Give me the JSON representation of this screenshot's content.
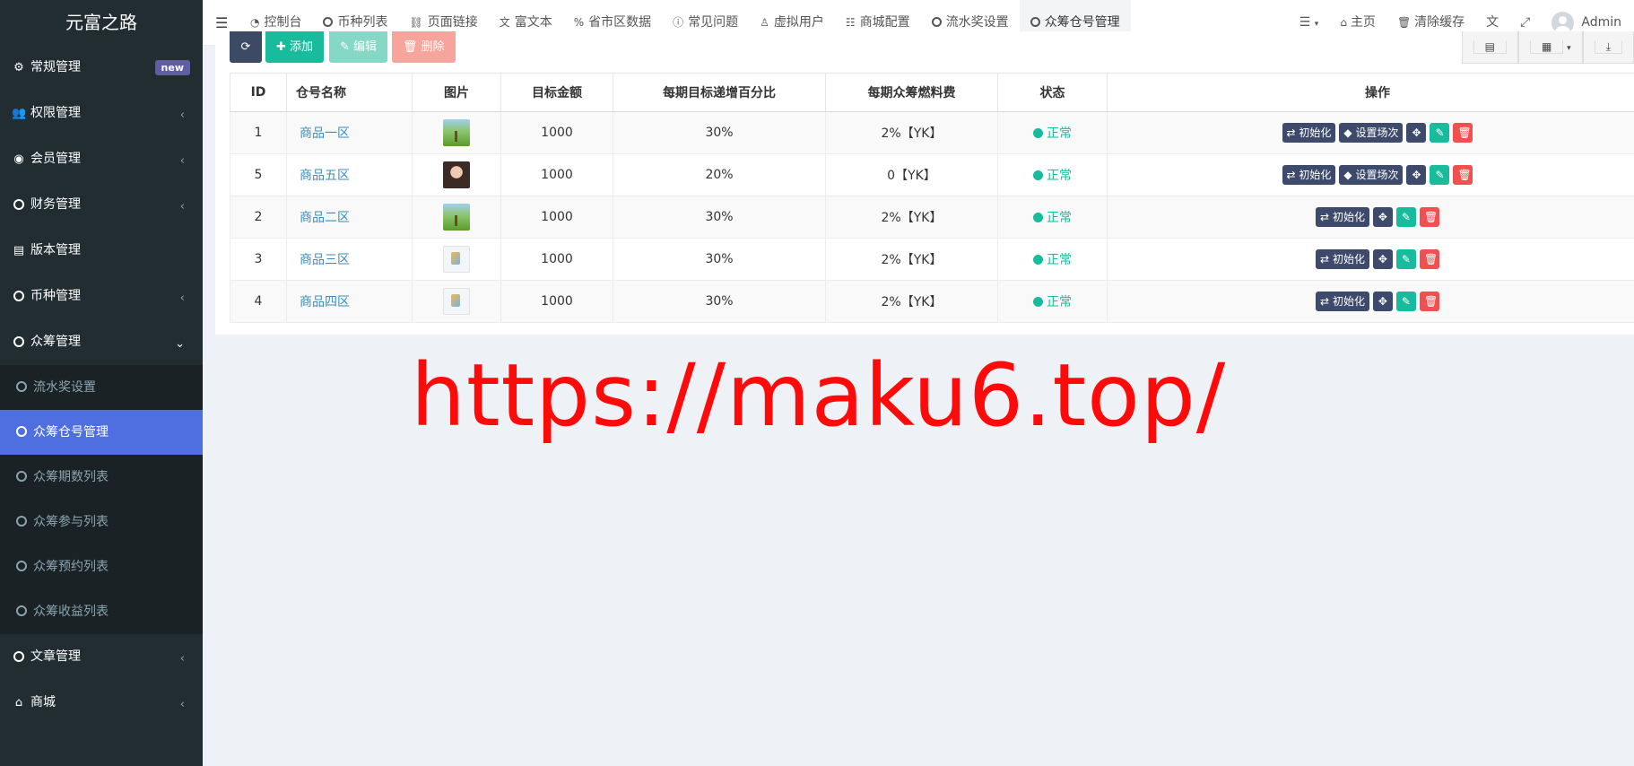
{
  "app": {
    "logo": "元富之路"
  },
  "sidebar": {
    "items": [
      {
        "icon": "cogs-icon",
        "label": "常规管理",
        "badge": "new"
      },
      {
        "icon": "users-icon",
        "label": "权限管理"
      },
      {
        "icon": "user-circle-icon",
        "label": "会员管理"
      },
      {
        "icon": "circle-icon",
        "label": "财务管理"
      },
      {
        "icon": "file-icon",
        "label": "版本管理"
      },
      {
        "icon": "circle-icon",
        "label": "币种管理"
      },
      {
        "icon": "circle-icon",
        "label": "众筹管理"
      }
    ],
    "submenu": [
      {
        "label": "流水奖设置"
      },
      {
        "label": "众筹仓号管理",
        "active": true
      },
      {
        "label": "众筹期数列表"
      },
      {
        "label": "众筹参与列表"
      },
      {
        "label": "众筹预约列表"
      },
      {
        "label": "众筹收益列表"
      }
    ],
    "after": [
      {
        "icon": "circle-icon",
        "label": "文章管理"
      },
      {
        "icon": "home-icon",
        "label": "商城"
      }
    ]
  },
  "topnav": {
    "tabs": [
      {
        "icon": "dashboard-icon",
        "label": "控制台"
      },
      {
        "icon": "circle-icon",
        "label": "币种列表"
      },
      {
        "icon": "link-icon",
        "label": "页面链接"
      },
      {
        "icon": "translate-icon",
        "label": "富文本"
      },
      {
        "icon": "percent-icon",
        "label": "省市区数据"
      },
      {
        "icon": "info-icon",
        "label": "常见问题"
      },
      {
        "icon": "user-icon",
        "label": "虚拟用户"
      },
      {
        "icon": "sliders-icon",
        "label": "商城配置"
      },
      {
        "icon": "circle-icon",
        "label": "流水奖设置"
      },
      {
        "icon": "circle-icon",
        "label": "众筹仓号管理",
        "active": true
      }
    ],
    "right": {
      "home": "主页",
      "clear_cache": "清除缓存",
      "user": "Admin"
    }
  },
  "toolbar": {
    "add": "添加",
    "edit": "编辑",
    "delete": "删除"
  },
  "table": {
    "headers": [
      "ID",
      "仓号名称",
      "图片",
      "目标金额",
      "每期目标递增百分比",
      "每期众筹燃料费",
      "状态",
      "操作"
    ],
    "rows": [
      {
        "id": "1",
        "name": "商品一区",
        "image": "tree",
        "target": "1000",
        "pct": "30%",
        "fee": "2%【YK】",
        "status": "正常",
        "set_scene": true
      },
      {
        "id": "5",
        "name": "商品五区",
        "image": "portrait",
        "target": "1000",
        "pct": "20%",
        "fee": "0【YK】",
        "status": "正常",
        "set_scene": true
      },
      {
        "id": "2",
        "name": "商品二区",
        "image": "tree",
        "target": "1000",
        "pct": "30%",
        "fee": "2%【YK】",
        "status": "正常",
        "set_scene": false
      },
      {
        "id": "3",
        "name": "商品三区",
        "image": "sketch",
        "target": "1000",
        "pct": "30%",
        "fee": "2%【YK】",
        "status": "正常",
        "set_scene": false
      },
      {
        "id": "4",
        "name": "商品四区",
        "image": "sketch",
        "target": "1000",
        "pct": "30%",
        "fee": "2%【YK】",
        "status": "正常",
        "set_scene": false
      }
    ],
    "actions": {
      "init": "初始化",
      "set_scene": "设置场次"
    }
  },
  "watermark": "https://maku6.top/",
  "colors": {
    "sidebar_bg": "#222d32",
    "active": "#4f6fe0",
    "success": "#18bc9c",
    "danger": "#f05050",
    "link": "#3c8dbc",
    "watermark": "#ff0a0a"
  }
}
